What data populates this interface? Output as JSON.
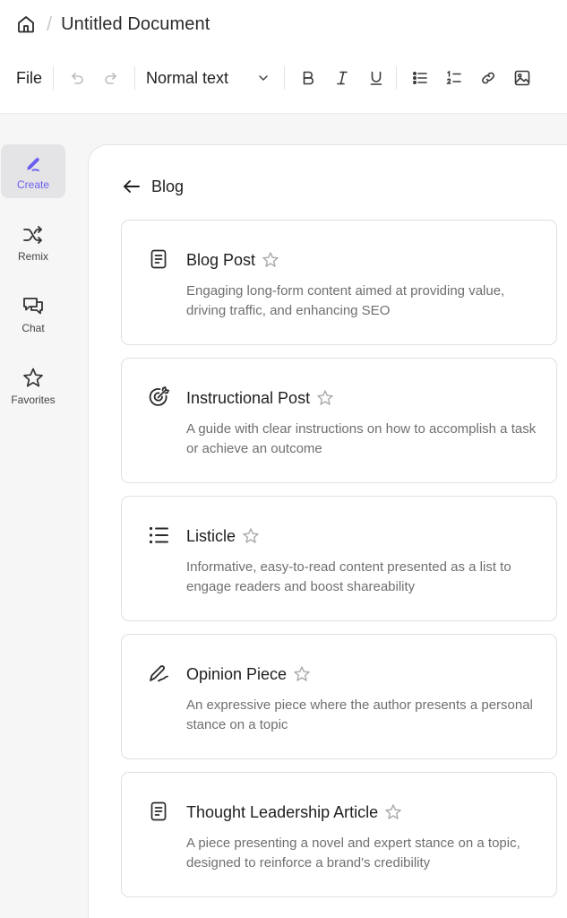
{
  "header": {
    "doc_title": "Untitled Document",
    "separator": "/"
  },
  "toolbar": {
    "file_label": "File",
    "text_style": "Normal text"
  },
  "sidebar": {
    "items": [
      {
        "label": "Create",
        "icon": "pen-icon",
        "active": true
      },
      {
        "label": "Remix",
        "icon": "shuffle-icon"
      },
      {
        "label": "Chat",
        "icon": "chat-icon"
      },
      {
        "label": "Favorites",
        "icon": "star-icon"
      }
    ]
  },
  "panel": {
    "back_label": "Blog",
    "cards": [
      {
        "title": "Blog Post",
        "icon": "document-icon",
        "description": "Engaging long-form content aimed at providing value, driving traffic, and enhancing SEO"
      },
      {
        "title": "Instructional Post",
        "icon": "target-icon",
        "description": "A guide with clear instructions on how to accomplish a task or achieve an outcome"
      },
      {
        "title": "Listicle",
        "icon": "list-icon",
        "description": "Informative, easy-to-read content presented as a list to engage readers and boost shareability"
      },
      {
        "title": "Opinion Piece",
        "icon": "pen-nib-icon",
        "description": "An expressive piece where the author presents a personal stance on a topic"
      },
      {
        "title": "Thought Leadership Article",
        "icon": "document-icon",
        "description": "A piece presenting a novel and expert stance on a topic, designed to reinforce a brand's credibility"
      }
    ]
  },
  "colors": {
    "accent": "#6b5cf2",
    "background": "#f6f6f6",
    "card_border": "#e0e0e0"
  }
}
